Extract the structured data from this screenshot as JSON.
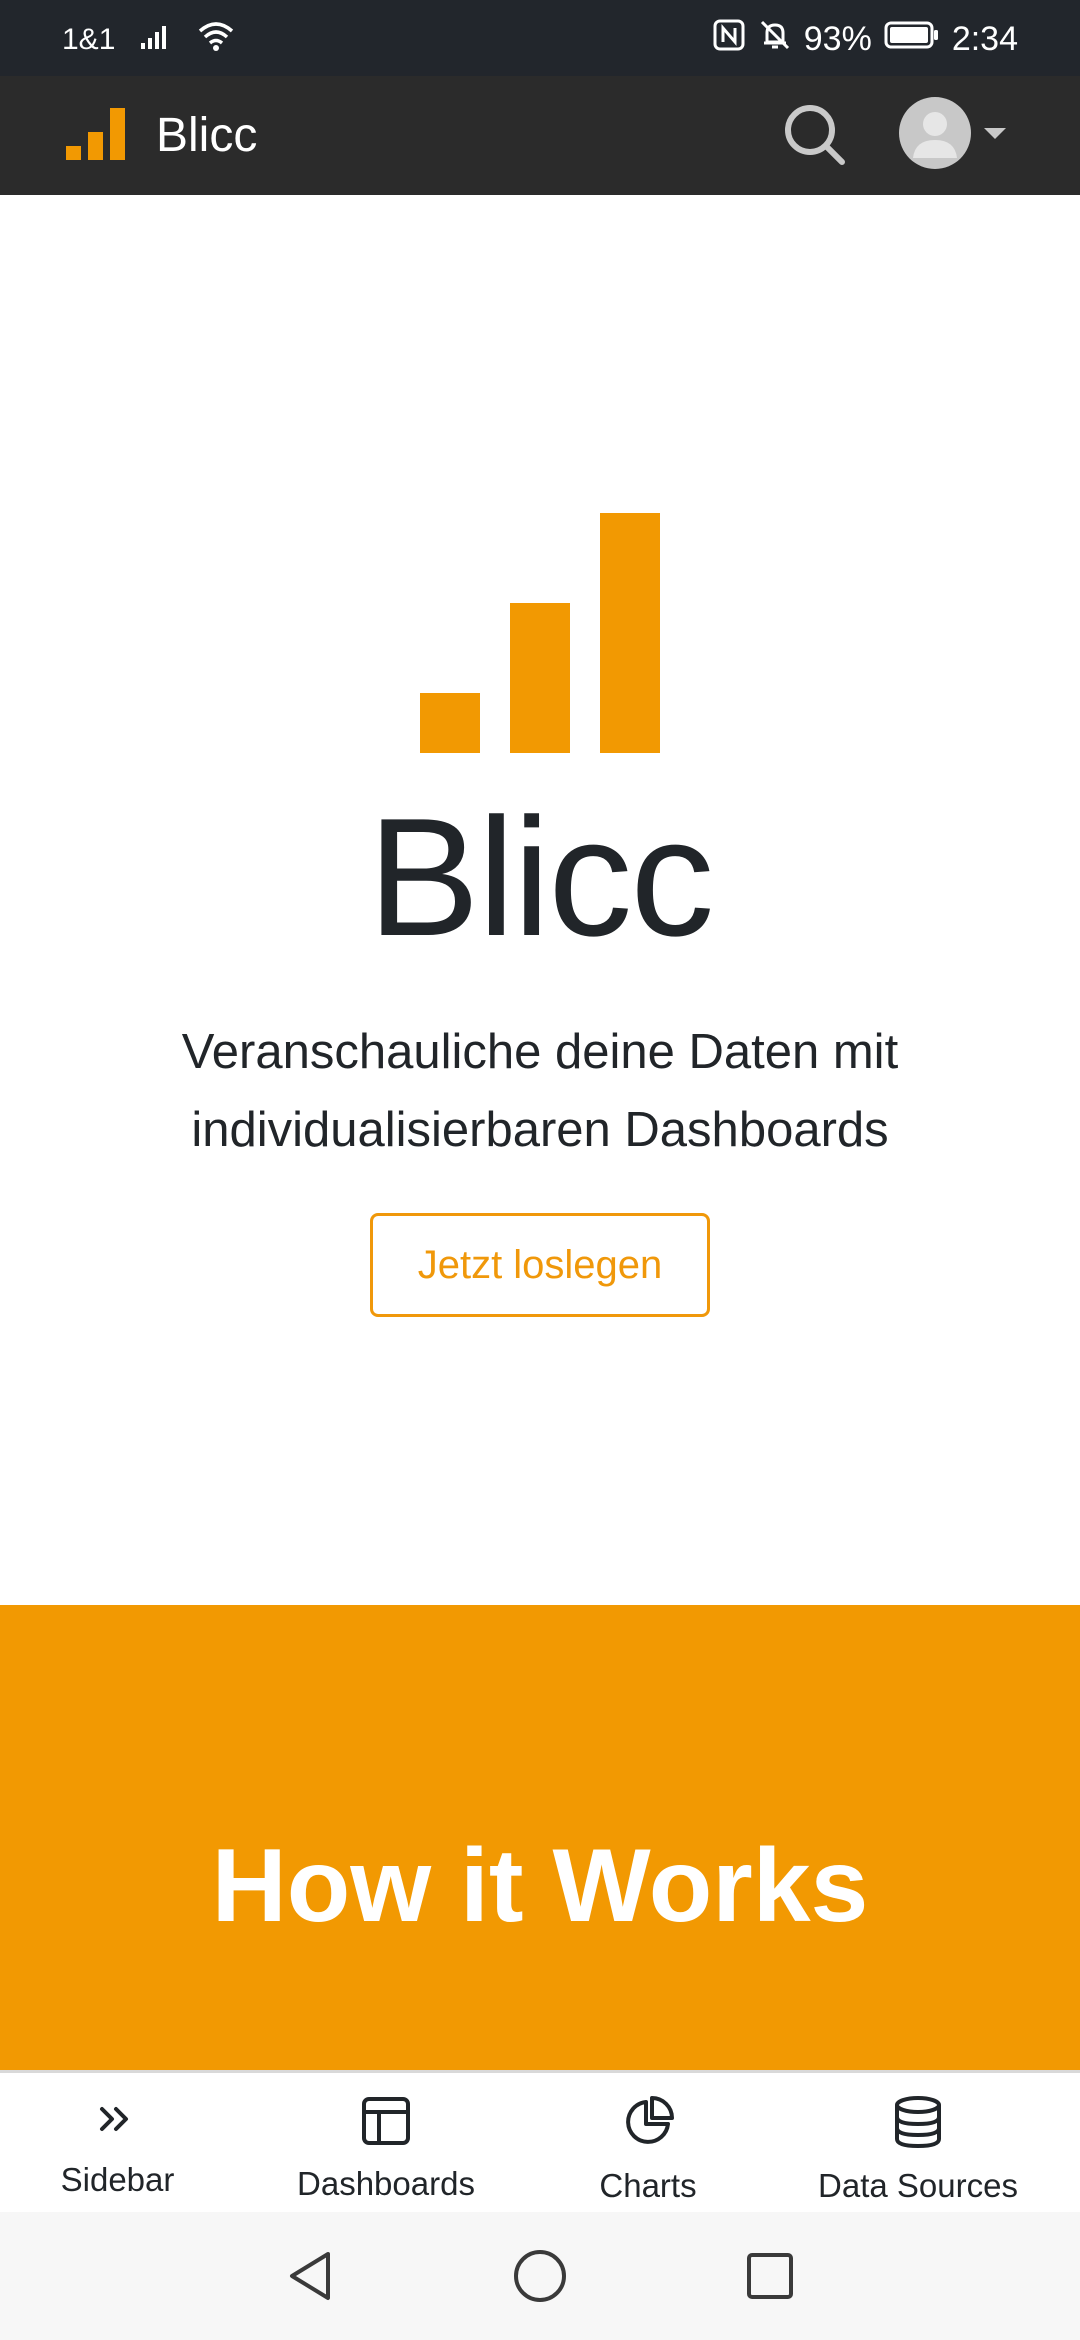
{
  "status_bar": {
    "carrier": "1&1",
    "battery": "93%",
    "time": "2:34",
    "icons": [
      "signal-icon",
      "wifi-icon",
      "nfc-icon",
      "bell-off-icon",
      "battery-icon"
    ]
  },
  "app_bar": {
    "brand": "Blicc",
    "icons": [
      "logo-icon",
      "search-icon",
      "avatar-icon",
      "caret-down-icon"
    ]
  },
  "hero": {
    "title": "Blicc",
    "subtitle": "Veranschauliche deine Daten mit individualisierbaren Dashboards",
    "cta_label": "Jetzt loslegen"
  },
  "how_it_works": {
    "title": "How it Works"
  },
  "bottom_nav": {
    "items": [
      {
        "label": "Sidebar",
        "icon": "double-chevron-right-icon"
      },
      {
        "label": "Dashboards",
        "icon": "dashboard-layout-icon"
      },
      {
        "label": "Charts",
        "icon": "pie-chart-icon"
      },
      {
        "label": "Data Sources",
        "icon": "database-icon"
      }
    ]
  },
  "system_nav": {
    "icons": [
      "back-icon",
      "home-icon",
      "recents-icon"
    ]
  },
  "colors": {
    "accent": "#f29902",
    "dark_bar": "#2b2b2b",
    "status_bar": "#22262c",
    "text": "#212529"
  }
}
